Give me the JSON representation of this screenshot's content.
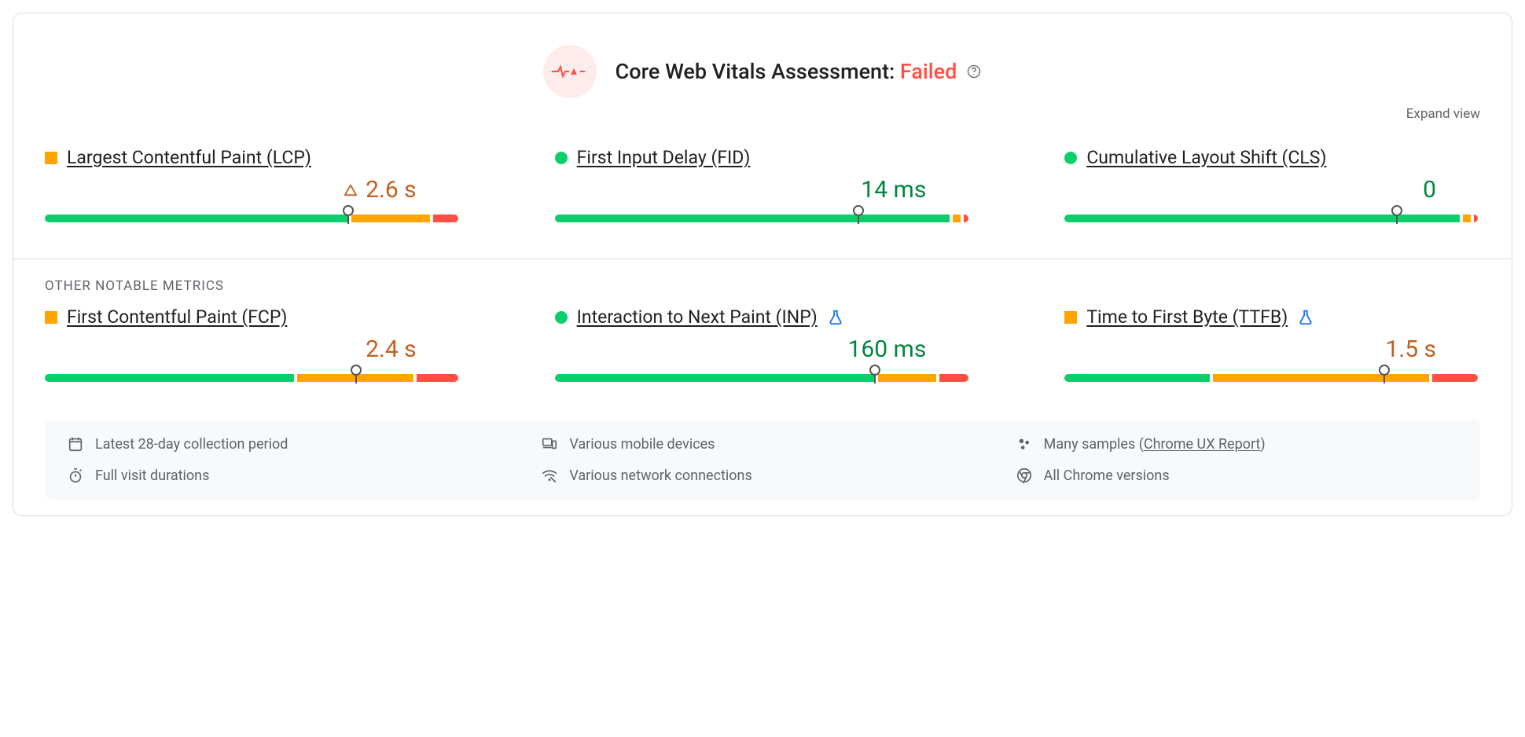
{
  "header": {
    "title_prefix": "Core Web Vitals Assessment: ",
    "status": "Failed"
  },
  "expand_label": "Expand view",
  "section_other_label": "OTHER NOTABLE METRICS",
  "metrics_core": [
    {
      "name": "Largest Contentful Paint (LCP)",
      "status": "ni",
      "value": "2.6 s",
      "show_warn_icon": true,
      "bar": {
        "good": 73,
        "ni": 19,
        "poor": 6
      },
      "marker_pct": 73
    },
    {
      "name": "First Input Delay (FID)",
      "status": "good",
      "value": "14 ms",
      "show_warn_icon": false,
      "bar": {
        "good": 95,
        "ni": 2,
        "poor": 1
      },
      "marker_pct": 73
    },
    {
      "name": "Cumulative Layout Shift (CLS)",
      "status": "good",
      "value": "0",
      "show_warn_icon": false,
      "bar": {
        "good": 95,
        "ni": 2,
        "poor": 1
      },
      "marker_pct": 80
    }
  ],
  "metrics_other": [
    {
      "name": "First Contentful Paint (FCP)",
      "status": "ni",
      "value": "2.4 s",
      "show_warn_icon": false,
      "experimental": false,
      "bar": {
        "good": 60,
        "ni": 28,
        "poor": 10
      },
      "marker_pct": 75
    },
    {
      "name": "Interaction to Next Paint (INP)",
      "status": "good",
      "value": "160 ms",
      "show_warn_icon": false,
      "experimental": true,
      "bar": {
        "good": 77,
        "ni": 14,
        "poor": 7
      },
      "marker_pct": 77
    },
    {
      "name": "Time to First Byte (TTFB)",
      "status": "ni",
      "value": "1.5 s",
      "show_warn_icon": false,
      "experimental": true,
      "bar": {
        "good": 35,
        "ni": 52,
        "poor": 11
      },
      "marker_pct": 77
    }
  ],
  "footer": {
    "period": "Latest 28-day collection period",
    "devices": "Various mobile devices",
    "samples_prefix": "Many samples (",
    "samples_link": "Chrome UX Report",
    "samples_suffix": ")",
    "durations": "Full visit durations",
    "network": "Various network connections",
    "chrome": "All Chrome versions"
  }
}
